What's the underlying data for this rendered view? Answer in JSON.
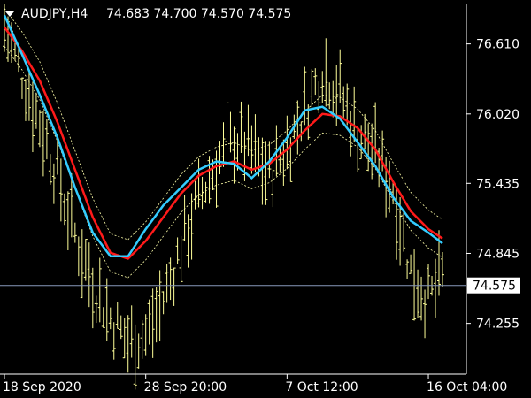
{
  "header": {
    "symbol": "AUDJPY,H4",
    "ohlc": "74.683 74.700 74.570 74.575",
    "menu_icon": "triangle-down-icon"
  },
  "price_axis": {
    "labels": [
      "76.610",
      "76.020",
      "75.435",
      "74.845",
      "74.255"
    ],
    "current_price": "74.575"
  },
  "time_axis": {
    "labels": [
      "18 Sep 2020",
      "28 Sep 20:00",
      "7 Oct 12:00",
      "16 Oct 04:00"
    ]
  },
  "colors": {
    "background": "#000000",
    "bars": "#ffff99",
    "ma_red": "#ff1a1a",
    "ma_blue": "#33ccff",
    "envelope": "#ffffaa",
    "current_price_line": "#8899bb",
    "axis_line": "#ffffff",
    "price_box_bg": "#ffffff",
    "price_box_text": "#000000"
  },
  "chart_data": {
    "type": "line",
    "ylim": [
      73.85,
      76.95
    ],
    "price_ticks": [
      76.61,
      76.02,
      75.435,
      74.845,
      74.255
    ],
    "current_price": 74.575,
    "x_tick_bars": [
      0,
      40,
      80,
      120
    ],
    "x": [
      0,
      5,
      10,
      15,
      20,
      25,
      30,
      35,
      40,
      45,
      50,
      55,
      60,
      65,
      70,
      75,
      80,
      85,
      90,
      95,
      100,
      105,
      110,
      115,
      120,
      124
    ],
    "price_path": [
      76.75,
      76.35,
      75.95,
      75.5,
      75.0,
      74.6,
      74.3,
      74.1,
      74.15,
      74.45,
      74.9,
      75.3,
      75.6,
      75.8,
      75.7,
      75.5,
      75.75,
      76.05,
      76.4,
      76.2,
      75.85,
      75.7,
      75.4,
      74.7,
      74.45,
      74.65
    ],
    "series": [
      {
        "values": [
          76.75,
          76.55,
          76.3,
          75.95,
          75.55,
          75.15,
          74.85,
          74.8,
          74.95,
          75.15,
          75.35,
          75.5,
          75.58,
          75.62,
          75.55,
          75.6,
          75.72,
          75.88,
          76.02,
          76.0,
          75.9,
          75.72,
          75.45,
          75.2,
          75.05,
          74.97
        ]
      },
      {
        "values": [
          76.85,
          76.52,
          76.18,
          75.82,
          75.4,
          75.02,
          74.82,
          74.82,
          75.05,
          75.25,
          75.4,
          75.55,
          75.62,
          75.6,
          75.48,
          75.62,
          75.82,
          76.05,
          76.08,
          75.98,
          75.78,
          75.58,
          75.32,
          75.12,
          75.02,
          74.93
        ]
      }
    ]
  }
}
